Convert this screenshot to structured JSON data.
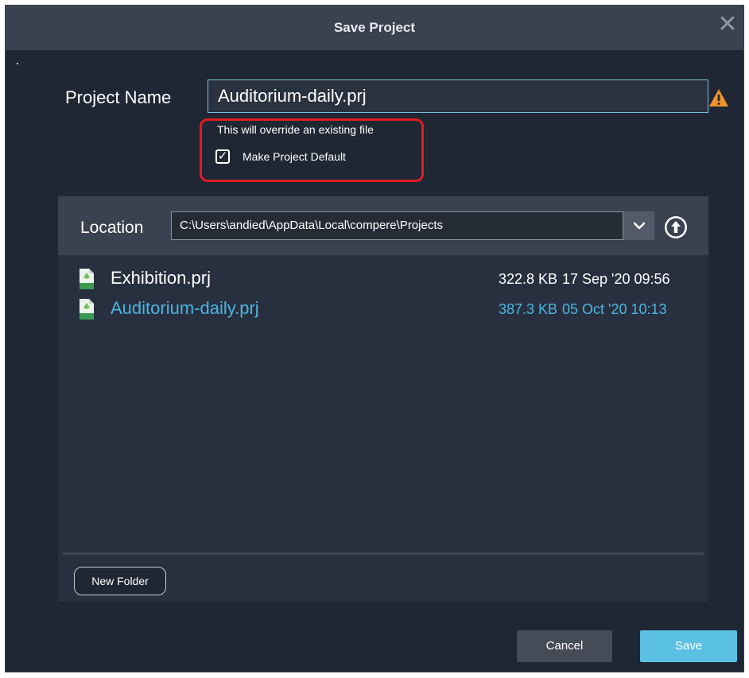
{
  "window": {
    "title": "Save Project",
    "close_symbol": "✕"
  },
  "project_name": {
    "label": "Project Name",
    "value": "Auditorium-daily.prj",
    "warning_icon": "warning-triangle-icon"
  },
  "override": {
    "message": "This will override an existing file",
    "checkbox_label": "Make Project Default",
    "checked": true,
    "check_mark": "✓"
  },
  "location": {
    "label": "Location",
    "path": "C:\\Users\\andied\\AppData\\Local\\compere\\Projects",
    "dropdown_icon": "chevron-down-icon",
    "up_icon": "arrow-up-circle-icon"
  },
  "files": [
    {
      "name": "Exhibition.prj",
      "size": "322.8 KB",
      "date": "17 Sep '20 09:56",
      "selected": false
    },
    {
      "name": "Auditorium-daily.prj",
      "size": "387.3 KB",
      "date": "05 Oct '20 10:13",
      "selected": true
    }
  ],
  "buttons": {
    "new_folder": "New Folder",
    "cancel": "Cancel",
    "save": "Save"
  },
  "colors": {
    "accent": "#4bb6e1",
    "warning": "#f0922b",
    "highlight": "#e21b23"
  }
}
